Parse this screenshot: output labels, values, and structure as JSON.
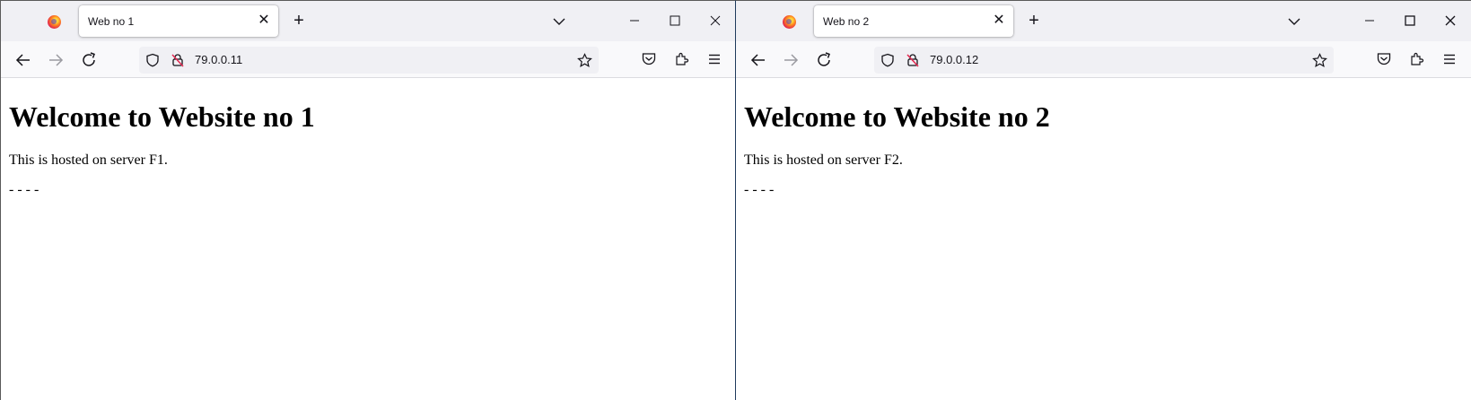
{
  "windows": [
    {
      "tab_title": "Web no 1",
      "url": "79.0.0.11",
      "heading": "Welcome to Website no 1",
      "paragraph": "This is hosted on server F1.",
      "separator": "- - - -"
    },
    {
      "tab_title": "Web no 2",
      "url": "79.0.0.12",
      "heading": "Welcome to Website no 2",
      "paragraph": "This is hosted on server F2.",
      "separator": "- - - -"
    }
  ],
  "icons": {
    "browser_logo": "firefox-icon",
    "tab_close": "close-icon",
    "new_tab": "plus-icon",
    "list_tabs": "chevron-down-icon",
    "minimize": "minimize-icon",
    "maximize": "maximize-icon",
    "close": "close-icon",
    "back": "back-arrow-icon",
    "forward": "forward-arrow-icon",
    "reload": "reload-icon",
    "tracking": "shield-icon",
    "insecure": "lock-slash-icon",
    "bookmark": "star-icon",
    "pocket": "pocket-icon",
    "extensions": "puzzle-icon",
    "menu": "hamburger-menu-icon"
  },
  "colors": {
    "tabbar_bg": "#f0f0f4",
    "navbar_bg": "#f9f9fb",
    "urlbar_bg": "#f0f0f4",
    "text": "#15141a",
    "insecure_accent": "#e22850"
  }
}
